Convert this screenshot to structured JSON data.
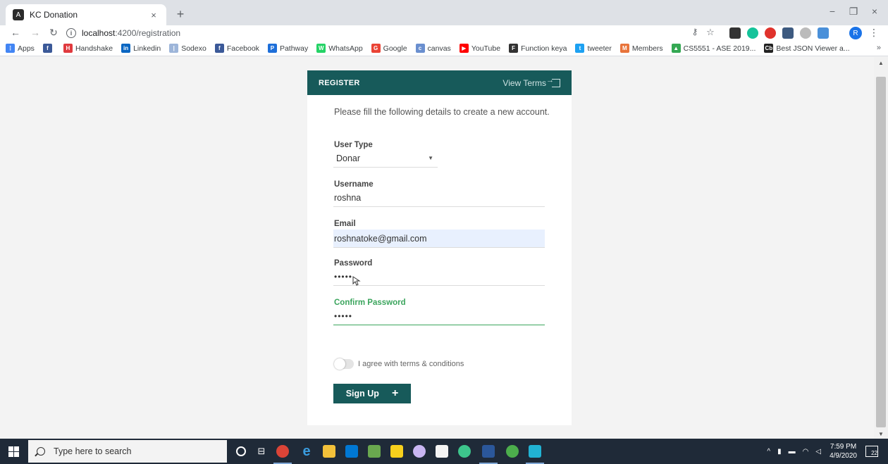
{
  "browser": {
    "tab_title": "KC Donation",
    "tab_close": "×",
    "new_tab": "+",
    "url_host": "localhost",
    "url_path": ":4200/registration",
    "profile_initial": "R",
    "window_controls": [
      "−",
      "❐",
      "×"
    ]
  },
  "bookmarks": [
    {
      "label": "Apps",
      "color": "#4285f4",
      "glyph": "⋮"
    },
    {
      "label": "",
      "color": "#3b5998",
      "glyph": "f"
    },
    {
      "label": "Handshake",
      "color": "#e03a3e",
      "glyph": "H"
    },
    {
      "label": "Linkedin",
      "color": "#0a66c2",
      "glyph": "in"
    },
    {
      "label": "Sodexo",
      "color": "#9db5d9",
      "glyph": "|"
    },
    {
      "label": "Facebook",
      "color": "#3b5998",
      "glyph": "f"
    },
    {
      "label": "Pathway",
      "color": "#1e6fd9",
      "glyph": "P"
    },
    {
      "label": "WhatsApp",
      "color": "#25d366",
      "glyph": "W"
    },
    {
      "label": "Google",
      "color": "#ea4335",
      "glyph": "G"
    },
    {
      "label": "canvas",
      "color": "#6a8fcf",
      "glyph": "c"
    },
    {
      "label": "YouTube",
      "color": "#ff0000",
      "glyph": "▶"
    },
    {
      "label": "Function keya",
      "color": "#333333",
      "glyph": "F"
    },
    {
      "label": "tweeter",
      "color": "#1da1f2",
      "glyph": "t"
    },
    {
      "label": "Members",
      "color": "#e8743b",
      "glyph": "M"
    },
    {
      "label": "CS5551 - ASE 2019...",
      "color": "#34a853",
      "glyph": "▲"
    },
    {
      "label": "Best JSON Viewer a...",
      "color": "#222222",
      "glyph": "Cb"
    }
  ],
  "bookmarks_more": "»",
  "card": {
    "header_title": "REGISTER",
    "view_terms": "View Terms",
    "intro": "Please fill the following details to create a new account.",
    "user_type_label": "User Type",
    "user_type_value": "Donar",
    "username_label": "Username",
    "username_value": "roshna",
    "email_label": "Email",
    "email_value": "roshnatoke@gmail.com",
    "password_label": "Password",
    "password_value": "•••••",
    "confirm_label": "Confirm Password",
    "confirm_value": "•••••",
    "agree_label": "I agree with terms & conditions",
    "signup_label": "Sign Up",
    "signup_icon": "+"
  },
  "colors": {
    "header_bg": "#175a5a",
    "accent_green": "#3ba55d",
    "email_autofill_bg": "#e8f0fe"
  },
  "taskbar": {
    "search_placeholder": "Type here to search",
    "time": "7:59 PM",
    "date": "4/9/2020",
    "notification_count": "22"
  }
}
